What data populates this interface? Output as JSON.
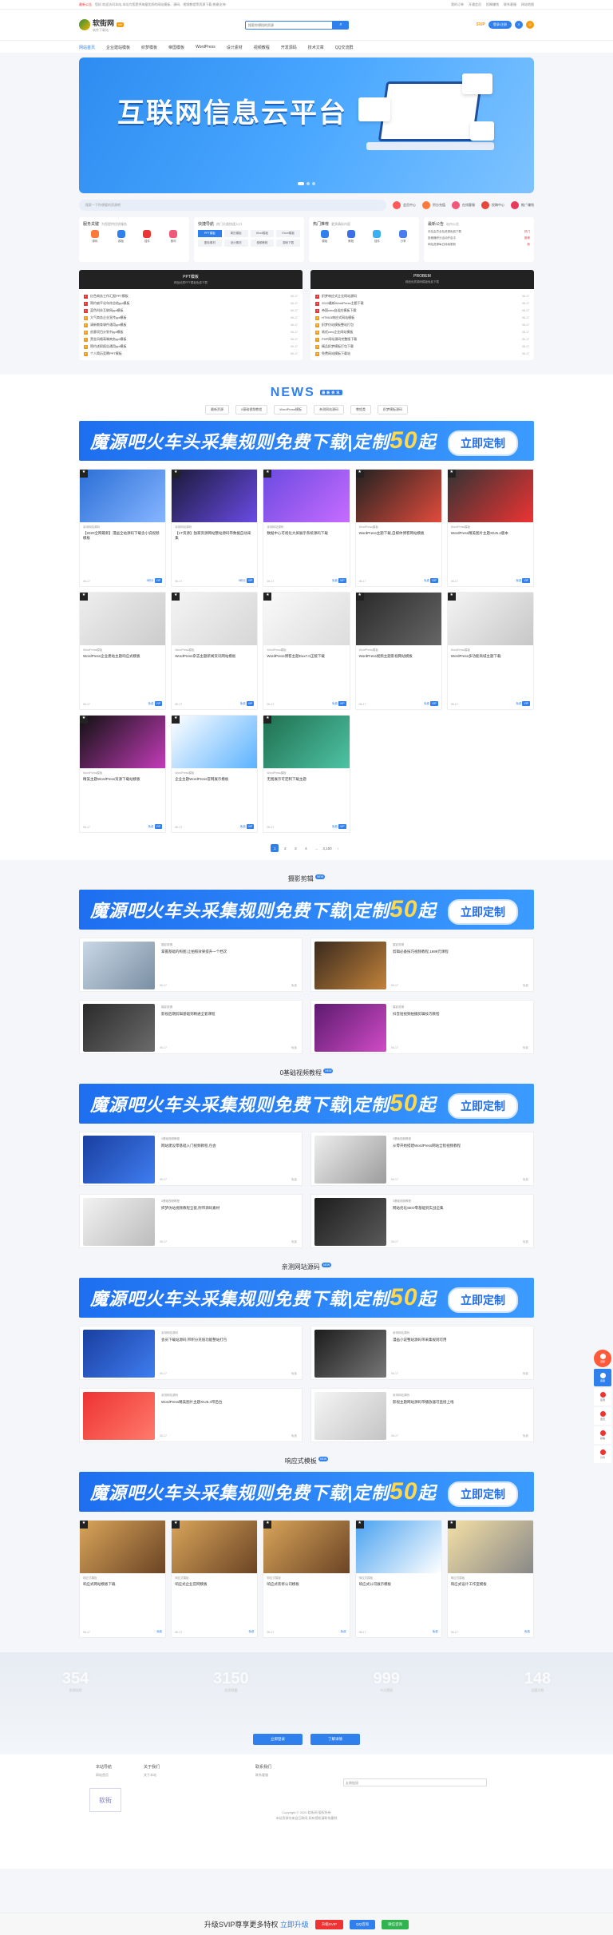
{
  "topbar": {
    "notice": "最新公告",
    "marquee": "您好,欢迎访问本站,本站为您提供海量优质的网站模板、源码、视频教程等资源下载,感谢支持!",
    "links": [
      "我的订单",
      "开通会员",
      "投稿赚钱",
      "联系客服",
      "网站地图"
    ]
  },
  "header": {
    "logo_text": "软街网",
    "logo_sub": "软件下载站",
    "logo_badge": "VIP",
    "search_placeholder": "搜索你想找的资源",
    "search_icon": "search-icon",
    "vip_tag": "SVIP",
    "login_label": "登录/注册"
  },
  "nav": [
    "网站首页",
    "企业建站模板",
    "织梦模板",
    "帝国模板",
    "WordPress",
    "设计素材",
    "视频教程",
    "开发源码",
    "技术文章",
    "QQ交流群"
  ],
  "hero": {
    "title": "互联网信息云平台"
  },
  "quick": {
    "search_placeholder": "搜索一下你想要的资源吧",
    "items": [
      "会员中心",
      "积分充值",
      "在线客服",
      "投稿中心",
      "推广赚钱"
    ]
  },
  "services": {
    "box1": {
      "title": "服务关键",
      "sub": "为您提供优质服务",
      "items": [
        "源码",
        "模板",
        "插件",
        "素材"
      ]
    },
    "box2": {
      "title": "快捷导航",
      "sub": "热门分类快速入口",
      "tags": [
        "PPT模板",
        "简历模板",
        "Word模板",
        "Excel模板",
        "图标素材",
        "设计素材",
        "视频教程",
        "源码下载"
      ]
    },
    "box3": {
      "title": "热门推荐",
      "sub": "更多精彩内容",
      "items": [
        "模板",
        "教程",
        "插件",
        "分享"
      ]
    },
    "box4": {
      "title": "最新公告",
      "sub": "站内公告",
      "list": [
        {
          "text": "本站会员全站资源免费下载",
          "tag": "热门"
        },
        {
          "text": "投稿赚积分活动开启中",
          "tag": "推荐"
        },
        {
          "text": "网站资源每日持续更新",
          "tag": "新"
        }
      ]
    }
  },
  "ppt": {
    "left_title": "PPT模板",
    "left_sub": "精品优质PPT模板免费下载",
    "left_list": [
      {
        "t": "红色商务工作汇报PPT模板",
        "d": "06-17"
      },
      {
        "t": "简约扁平化年终总结ppt模板",
        "d": "06-17"
      },
      {
        "t": "蓝色科技互联网ppt模板",
        "d": "06-17"
      },
      {
        "t": "大气商务企业宣传ppt模板",
        "d": "06-17"
      },
      {
        "t": "清新教育课件通用ppt模板",
        "d": "06-17"
      },
      {
        "t": "创意项目计划书ppt模板",
        "d": "06-17"
      },
      {
        "t": "黑金风格高端商务ppt模板",
        "d": "06-17"
      },
      {
        "t": "简约述职报告通用ppt模板",
        "d": "06-17"
      },
      {
        "t": "个人简历竞聘PPT模板",
        "d": "06-17"
      }
    ],
    "right_title": "PROBEM",
    "right_sub": "精品优质源码模板免费下载",
    "right_list": [
      {
        "t": "织梦响应式企业网站源码",
        "d": "06-17"
      },
      {
        "t": "2019最新WordPress主题下载",
        "d": "06-17"
      },
      {
        "t": "帝国cms自适应模板下载",
        "d": "06-17"
      },
      {
        "t": "HTML5响应式网站模板",
        "d": "06-17"
      },
      {
        "t": "织梦仿站模板整站打包",
        "d": "06-17"
      },
      {
        "t": "易优cms企业网站模板",
        "d": "06-17"
      },
      {
        "t": "PHP网站源码完整版下载",
        "d": "06-17"
      },
      {
        "t": "精品织梦模板打包下载",
        "d": "06-17"
      },
      {
        "t": "免费网站模板下载站",
        "d": "06-17"
      }
    ]
  },
  "news": {
    "title": "NEWS",
    "badge": "最新资讯",
    "tabs": [
      "最新资源",
      "0基础视频教程",
      "WordPress模板",
      "亲测网站源码",
      "教程类",
      "织梦模板源码"
    ],
    "ad_text": "魔源吧火车头采集规则免费下载|定制",
    "ad_price": "50",
    "ad_suffix": "起",
    "ad_button": "立即定制",
    "cards": [
      {
        "meta": "亲测网站源码",
        "title": "【2020全网最新】漫画全站源码下载含小说视频模板",
        "date": "06-17",
        "price": "5积分",
        "tag": "VIP",
        "c1": "#2b6fd6",
        "c2": "#86b5ff"
      },
      {
        "meta": "亲测网站源码",
        "title": "【1T资源】独家资源网站整站源码带数据自动采集",
        "date": "06-17",
        "price": "5积分",
        "tag": "VIP",
        "c1": "#1a1a3a",
        "c2": "#6a4be6"
      },
      {
        "meta": "亲测网站源码",
        "title": "数据中心可视化大屏展示系统源码下载",
        "date": "06-17",
        "price": "免费",
        "tag": "VIP",
        "c1": "#6b4be0",
        "c2": "#c86bff"
      },
      {
        "meta": "WordPress模板",
        "title": "WordPress主题下载,自媒体博客网站模板",
        "date": "06-17",
        "price": "免费",
        "tag": "VIP",
        "c1": "#222",
        "c2": "#e14b3b"
      },
      {
        "meta": "WordPress模板",
        "title": "WordPress精美图片主题XIU5.4版本",
        "date": "06-17",
        "price": "免费",
        "tag": "VIP",
        "c1": "#333",
        "c2": "#e33"
      },
      {
        "meta": "WordPress模板",
        "title": "WordPress企业建站主题响应式模板",
        "date": "06-17",
        "price": "免费",
        "tag": "VIP",
        "c1": "#eeeeee",
        "c2": "#cccccc"
      },
      {
        "meta": "WordPress模板",
        "title": "WordPress杂志主题新闻资讯网站模板",
        "date": "06-17",
        "price": "免费",
        "tag": "VIP",
        "c1": "#f4f4f4",
        "c2": "#d6d6d6"
      },
      {
        "meta": "WordPress模板",
        "title": "WordPress博客主题Dux7.0正版下载",
        "date": "06-17",
        "price": "免费",
        "tag": "VIP",
        "c1": "#fafafa",
        "c2": "#dcdcdc"
      },
      {
        "meta": "WordPress模板",
        "title": "WordPress视频主题影视网站模板",
        "date": "06-17",
        "price": "免费",
        "tag": "VIP",
        "c1": "#2a2a2a",
        "c2": "#666"
      },
      {
        "meta": "WordPress模板",
        "title": "WordPress多功能商城主题下载",
        "date": "06-17",
        "price": "免费",
        "tag": "VIP",
        "c1": "#f4f4f4",
        "c2": "#c7c7c7"
      },
      {
        "meta": "WordPress模板",
        "title": "精美主题WordPress资源下载站模板",
        "date": "06-17",
        "price": "免费",
        "tag": "VIP",
        "c1": "#111",
        "c2": "#c33bb9"
      },
      {
        "meta": "WordPress模板",
        "title": "企业主题WordPress官网展示模板",
        "date": "06-17",
        "price": "免费",
        "tag": "VIP",
        "c1": "#ffffff",
        "c2": "#5bb2ff"
      },
      {
        "meta": "WordPress模板",
        "title": "无图展示可定制下载主题",
        "date": "06-17",
        "price": "免费",
        "tag": "VIP",
        "c1": "#1f6f4f",
        "c2": "#4ec3a4"
      }
    ],
    "pager": [
      "1",
      "2",
      "3",
      "4",
      "...",
      "3,150",
      "›"
    ]
  },
  "categories": [
    {
      "title": "摄影剪辑",
      "cards": [
        {
          "meta": "摄影剪辑",
          "title": "掌握基础的构图,让拍照效果提升一个档次",
          "date": "06-17",
          "price": "免费",
          "c1": "#c9d7e6",
          "c2": "#7a8fa3"
        },
        {
          "meta": "摄影剪辑",
          "title": "剪辑必备技巧视频教程,1699元课程",
          "date": "06-17",
          "price": "免费",
          "c1": "#3a2a1e",
          "c2": "#c2823a"
        },
        {
          "meta": "摄影剪辑",
          "title": "影视后期剪辑基础到精通全套课程",
          "date": "06-17",
          "price": "免费",
          "c1": "#2b2b2b",
          "c2": "#6b6b6b"
        },
        {
          "meta": "摄影剪辑",
          "title": "抖音短视频拍摄剪辑技巧教程",
          "date": "06-17",
          "price": "免费",
          "c1": "#5c1a6e",
          "c2": "#d04bc6"
        }
      ]
    },
    {
      "title": "0基础视频教程",
      "cards": [
        {
          "meta": "0基础视频教程",
          "title": "网站建设零基础入门视频教程,包会",
          "date": "06-17",
          "price": "免费",
          "c1": "#1a3fa0",
          "c2": "#3f7df0"
        },
        {
          "meta": "0基础视频教程",
          "title": "从零开始搭建WordPress网站全程视频教程",
          "date": "06-17",
          "price": "免费",
          "c1": "#eeeeee",
          "c2": "#9c9c9c"
        },
        {
          "meta": "0基础视频教程",
          "title": "织梦仿站视频教程全套,附带源码素材",
          "date": "06-17",
          "price": "免费",
          "c1": "#f2f2f2",
          "c2": "#bcbcbc"
        },
        {
          "meta": "0基础视频教程",
          "title": "网站优化SEO零基础到实战全集",
          "date": "06-17",
          "price": "免费",
          "c1": "#1d1d1d",
          "c2": "#5a5a5a"
        }
      ]
    },
    {
      "title": "亲测网站源码",
      "cards": [
        {
          "meta": "亲测网站源码",
          "title": "会员下载站源码,带积分充值功能整站打包",
          "date": "06-17",
          "price": "免费",
          "c1": "#1a3fa0",
          "c2": "#3f7df0"
        },
        {
          "meta": "亲测网站源码",
          "title": "漫画小说整站源码带采集规则可用",
          "date": "06-17",
          "price": "免费",
          "c1": "#1c1c1c",
          "c2": "#777"
        },
        {
          "meta": "亲测网站源码",
          "title": "WordPress精美图片主题XIU5.4带后台",
          "date": "06-17",
          "price": "免费",
          "c1": "#e33",
          "c2": "#ff7a6b"
        },
        {
          "meta": "亲测网站源码",
          "title": "影视主题网站源码带播放器可直接上线",
          "date": "06-17",
          "price": "免费",
          "c1": "#f5f5f5",
          "c2": "#c4c4c4"
        }
      ]
    }
  ],
  "responsive": {
    "title": "响应式模板",
    "cards": [
      {
        "meta": "响应式模板",
        "title": "响应式网站模板下载",
        "date": "06-17",
        "price": "免费",
        "c1": "#d9a55a",
        "c2": "#6b4425"
      },
      {
        "meta": "响应式模板",
        "title": "响应式企业官网模板",
        "date": "06-17",
        "price": "免费",
        "c1": "#d9a55a",
        "c2": "#6b4425"
      },
      {
        "meta": "响应式模板",
        "title": "响应式装修公司模板",
        "date": "06-17",
        "price": "免费",
        "c1": "#d9a55a",
        "c2": "#6b4425"
      },
      {
        "meta": "响应式模板",
        "title": "响应式公司展示模板",
        "date": "06-17",
        "price": "免费",
        "c1": "#4aa2f0",
        "c2": "#ffffff"
      },
      {
        "meta": "响应式模板",
        "title": "响应式设计工作室模板",
        "date": "06-17",
        "price": "免费",
        "c1": "#f4e0a6",
        "c2": "#888"
      }
    ]
  },
  "stats": [
    {
      "n": "354",
      "l": "资源总数"
    },
    {
      "n": "3150",
      "l": "会员数量"
    },
    {
      "n": "999",
      "l": "今日更新"
    },
    {
      "n": "148",
      "l": "运营天数"
    }
  ],
  "dark_buttons": [
    "立即登录",
    "了解详情"
  ],
  "footer": {
    "cols": [
      "本站导航",
      "关于我们",
      "联系我们"
    ],
    "subs": [
      "网站首页",
      "关于本站",
      "联系客服"
    ],
    "mark": "软街",
    "select": "友情链接",
    "copy1": "Copyright © 2020 软街网 版权所有",
    "copy2": "本站资源均来自互联网,如有侵权请联系删除"
  },
  "bottom_bar": {
    "text": "升级SVIP尊享更多特权",
    "link": "立即升级",
    "btn1": "升级SVIP",
    "btn2": "QQ咨询",
    "btn3": "微信咨询"
  },
  "side_tools": [
    "顶部",
    "客服",
    "签到",
    "会员",
    "投稿",
    "分享"
  ]
}
